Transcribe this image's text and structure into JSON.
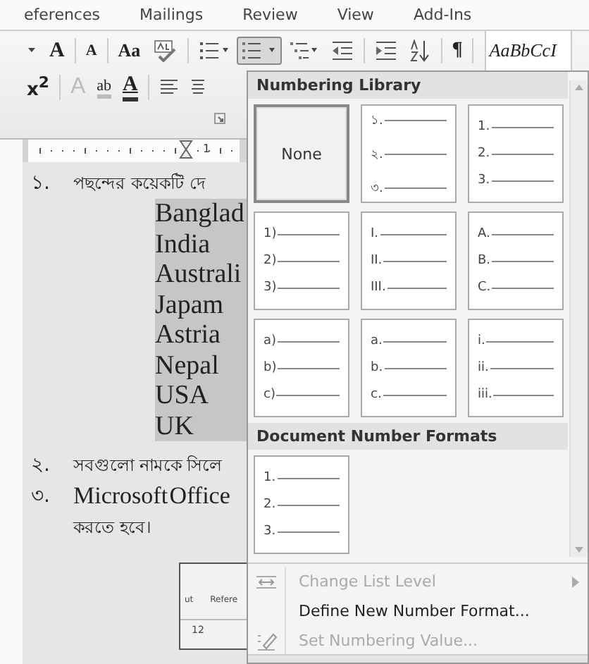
{
  "ribbon_tabs": [
    "eferences",
    "Mailings",
    "Review",
    "View",
    "Add-Ins"
  ],
  "ribbon": {
    "row_1": [
      {
        "kind": "dropdown-caret",
        "selected": false
      },
      {
        "kind": "grow-font",
        "text": "A",
        "selected": false
      },
      {
        "kind": "shrink-font",
        "text": "A",
        "selected": false
      },
      {
        "kind": "change-case",
        "text": "Aa",
        "selected": false
      },
      {
        "kind": "spelling",
        "selected": false
      },
      {
        "kind": "bullets",
        "selected": false
      },
      {
        "kind": "numbering",
        "selected": true
      },
      {
        "kind": "multilevel",
        "selected": false
      },
      {
        "kind": "outdent",
        "selected": false
      },
      {
        "kind": "indent",
        "selected": false
      },
      {
        "kind": "sort",
        "selected": false
      },
      {
        "kind": "pilcrow",
        "text": "¶",
        "selected": false
      },
      {
        "kind": "style-preview",
        "text": "AaBbCcI",
        "selected": false
      }
    ],
    "row_2": [
      {
        "kind": "superscript",
        "text": "x$^{2}$",
        "selected": false
      },
      {
        "kind": "text-effects",
        "text": "A",
        "selected": false
      },
      {
        "kind": "highlight",
        "text": "ab",
        "selected": false
      },
      {
        "kind": "font-color",
        "text": "A",
        "selected": false
      },
      {
        "kind": "align-left",
        "selected": false
      },
      {
        "kind": "align-center",
        "selected": false
      }
    ]
  },
  "ruler": {
    "number": "1"
  },
  "document": {
    "items": [
      {
        "number": "১.",
        "text": "পছন্দের কয়েকটি দে",
        "lines": [
          "Banglad",
          "India",
          "Australi",
          "Japam",
          "Astria",
          "Nepal",
          "USA",
          "UK"
        ]
      },
      {
        "number": "২.",
        "text": "সবগুলো নামকে সিলে"
      },
      {
        "number": "৩.",
        "text": "Microsoft Office",
        "continuation": "করতে হবে।"
      }
    ],
    "inset_screenshot": {
      "tabs": [
        "ut",
        "Refere"
      ],
      "font_size": "12"
    }
  },
  "numbering_menu": {
    "library_title": "Numbering Library",
    "library": [
      {
        "kind": "none",
        "label": "None",
        "selected": true
      },
      {
        "kind": "list",
        "markers": [
          "১.",
          "২.",
          "৩."
        ],
        "selected": false
      },
      {
        "kind": "list",
        "markers": [
          "1.",
          "2.",
          "3."
        ],
        "selected": false
      },
      {
        "kind": "list",
        "markers": [
          "1)",
          "2)",
          "3)"
        ],
        "selected": false
      },
      {
        "kind": "list",
        "markers": [
          "I.",
          "II.",
          "III."
        ],
        "selected": false
      },
      {
        "kind": "list",
        "markers": [
          "A.",
          "B.",
          "C."
        ],
        "selected": false
      },
      {
        "kind": "list",
        "markers": [
          "a)",
          "b)",
          "c)"
        ],
        "selected": false
      },
      {
        "kind": "list",
        "markers": [
          "a.",
          "b.",
          "c."
        ],
        "selected": false
      },
      {
        "kind": "list",
        "markers": [
          "i.",
          "ii.",
          "iii."
        ],
        "selected": false
      }
    ],
    "document_title": "Document Number Formats",
    "document_formats": [
      {
        "kind": "list",
        "markers": [
          "1.",
          "2.",
          "3."
        ],
        "selected": false
      }
    ],
    "commands": [
      {
        "kind": "change-level",
        "label": "Change List Level",
        "disabled": true,
        "submenu": true
      },
      {
        "kind": "define",
        "label": "Define New Number Format...",
        "disabled": false,
        "submenu": false
      },
      {
        "kind": "set-value",
        "label": "Set Numbering Value...",
        "disabled": true,
        "submenu": false
      }
    ]
  }
}
